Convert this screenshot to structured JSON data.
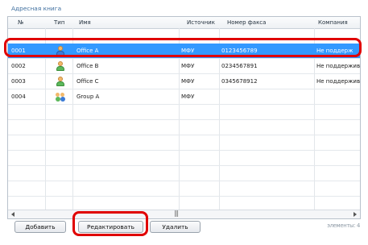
{
  "panel": {
    "title": "Адресная книга"
  },
  "columns": [
    "№",
    "Тип",
    "Имя",
    "Источник",
    "Номер факса",
    "Компания"
  ],
  "rows": [
    {
      "no": "0001",
      "type": "person-blue-icon",
      "name": "Office A",
      "source": "МФУ",
      "fax": "0123456789",
      "company": "Не поддерж",
      "selected": true
    },
    {
      "no": "0002",
      "type": "person-green-icon",
      "name": "Office B",
      "source": "МФУ",
      "fax": "0234567891",
      "company": "Не поддержив",
      "selected": false
    },
    {
      "no": "0003",
      "type": "person-green-icon",
      "name": "Office C",
      "source": "МФУ",
      "fax": "0345678912",
      "company": "Не поддержив",
      "selected": false
    },
    {
      "no": "0004",
      "type": "group-icon",
      "name": "Group A",
      "source": "МФУ",
      "fax": "",
      "company": "",
      "selected": false
    }
  ],
  "buttons": {
    "add": "Добавить",
    "edit": "Редактировать",
    "delete": "Удалить"
  },
  "status": {
    "items": "элементы: 4"
  },
  "colors": {
    "selection": "#3399ff",
    "highlight": "#e00000"
  }
}
